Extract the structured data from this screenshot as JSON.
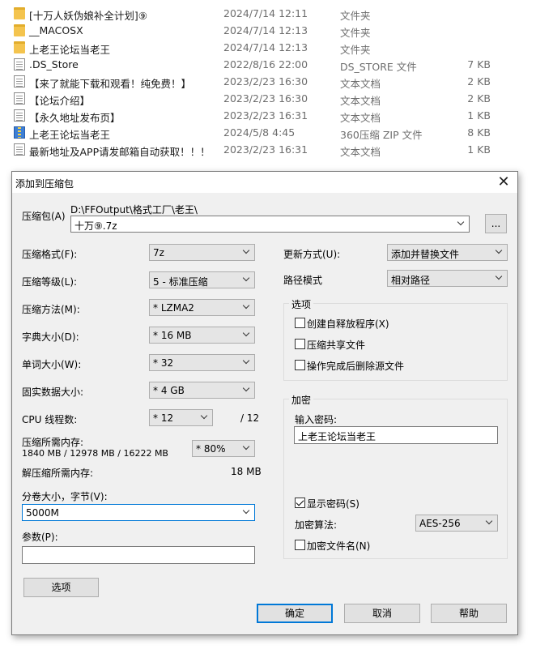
{
  "files": [
    {
      "name": "[十万人妖伪娘补全计划]⑨",
      "date": "2024/7/14 12:11",
      "type": "文件夹",
      "size": "",
      "icon": "folder-icon"
    },
    {
      "name": "__MACOSX",
      "date": "2024/7/14 12:13",
      "type": "文件夹",
      "size": "",
      "icon": "folder-icon"
    },
    {
      "name": "上老王论坛当老王",
      "date": "2024/7/14 12:13",
      "type": "文件夹",
      "size": "",
      "icon": "folder-icon"
    },
    {
      "name": ".DS_Store",
      "date": "2022/8/16 22:00",
      "type": "DS_STORE 文件",
      "size": "7 KB",
      "icon": "doc-icon"
    },
    {
      "name": "【来了就能下载和观看！纯免费！】",
      "date": "2023/2/23 16:30",
      "type": "文本文档",
      "size": "2 KB",
      "icon": "doc-icon"
    },
    {
      "name": "【论坛介绍】",
      "date": "2023/2/23 16:30",
      "type": "文本文档",
      "size": "2 KB",
      "icon": "doc-icon"
    },
    {
      "name": "【永久地址发布页】",
      "date": "2023/2/23 16:31",
      "type": "文本文档",
      "size": "1 KB",
      "icon": "doc-icon"
    },
    {
      "name": "上老王论坛当老王",
      "date": "2024/5/8 4:45",
      "type": "360压缩 ZIP 文件",
      "size": "8 KB",
      "icon": "zip-icon"
    },
    {
      "name": "最新地址及APP请发邮箱自动获取！！！",
      "date": "2023/2/23 16:31",
      "type": "文本文档",
      "size": "1 KB",
      "icon": "doc-icon"
    }
  ],
  "dialog": {
    "title": "添加到压缩包",
    "close": "✕",
    "archive_label": "压缩包(A)",
    "archive_path": "D:\\FFOutput\\格式工厂\\老王\\",
    "archive_name": "十万⑨.7z",
    "browse": "...",
    "format": {
      "label": "压缩格式(F):",
      "value": "7z"
    },
    "level": {
      "label": "压缩等级(L):",
      "value": "5 - 标准压缩"
    },
    "method": {
      "label": "压缩方法(M):",
      "value": "*  LZMA2"
    },
    "dict": {
      "label": "字典大小(D):",
      "value": "*  16 MB"
    },
    "word": {
      "label": "单词大小(W):",
      "value": "*  32"
    },
    "solid": {
      "label": "固实数据大小:",
      "value": "*  4 GB"
    },
    "threads": {
      "label": "CPU 线程数:",
      "value": "*  12",
      "max": "/ 12"
    },
    "mem_compress": {
      "label": "压缩所需内存:",
      "detail": "1840 MB / 12978 MB / 16222 MB",
      "value": "* 80%"
    },
    "mem_decompress": {
      "label": "解压缩所需内存:",
      "value": "18 MB"
    },
    "volume": {
      "label": "分卷大小，字节(V):",
      "value": "5000M"
    },
    "params": {
      "label": "参数(P):",
      "value": ""
    },
    "options_button": "选项",
    "update": {
      "label": "更新方式(U):",
      "value": "添加并替换文件"
    },
    "path_mode": {
      "label": "路径模式",
      "value": "相对路径"
    },
    "options_group": {
      "title": "选项",
      "sfx": "创建自释放程序(X)",
      "shared": "压缩共享文件",
      "delete_after": "操作完成后删除源文件"
    },
    "encryption": {
      "title": "加密",
      "password_label": "输入密码:",
      "password": "上老王论坛当老王",
      "show_password": "显示密码(S)",
      "method_label": "加密算法:",
      "method": "AES-256",
      "encrypt_names": "加密文件名(N)"
    },
    "ok": "确定",
    "cancel": "取消",
    "help": "帮助"
  }
}
